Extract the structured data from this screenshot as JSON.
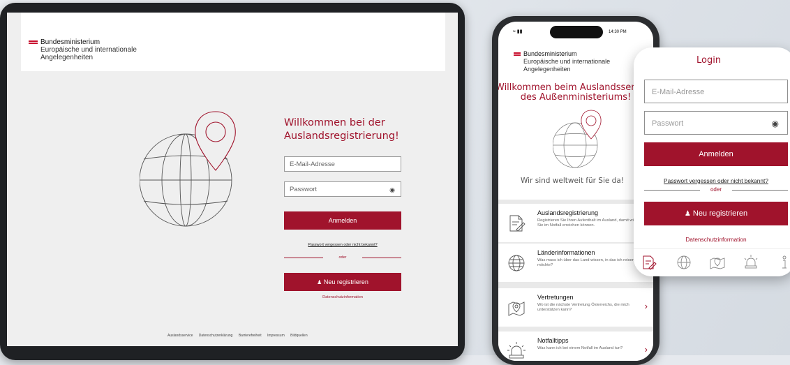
{
  "tablet": {
    "brand_line1": "Bundesministerium",
    "brand_line2": "Europäische und internationale",
    "brand_line3": "Angelegenheiten",
    "welcome_line1": "Willkommen bei der",
    "welcome_line2": "Auslandsregistrierung!",
    "email_placeholder": "E-Mail-Adresse",
    "password_placeholder": "Passwort",
    "login_label": "Anmelden",
    "forgot_label": "Passwort vergessen oder nicht bekannt?",
    "or_label": "oder",
    "register_label": "Neu registrieren",
    "privacy_label": "Datenschutzinformation",
    "footer": [
      "Auslandsservice",
      "Datenschutzerklärung",
      "Barrierefreiheit",
      "Impressum",
      "Bildquellen"
    ]
  },
  "phone": {
    "time": "14:30 PM",
    "brand_line1": "Bundesministerium",
    "brand_line2": "Europäische und internationale",
    "brand_line3": "Angelegenheiten",
    "welcome_line1": "Willkommen beim Auslandsservice",
    "welcome_line2": "des Außenministeriums!",
    "subtitle": "Wir sind weltweit für Sie da!",
    "items": [
      {
        "title": "Auslandsregistrierung",
        "desc": "Registrieren Sie Ihren Aufenthalt im Ausland, damit wir Sie im Notfall erreichen können.",
        "icon": "registration-icon"
      },
      {
        "title": "Länderinformationen",
        "desc": "Was muss ich über das Land wissen, in das ich reisen möchte?",
        "icon": "globe-icon"
      },
      {
        "title": "Vertretungen",
        "desc": "Wo ist die nächste Vertretung Österreichs, die mich unterstützen kann?",
        "icon": "map-pin-icon"
      },
      {
        "title": "Notfalltipps",
        "desc": "Was kann ich bei einem Notfall im Ausland tun?",
        "icon": "siren-icon"
      }
    ]
  },
  "card": {
    "title": "Login",
    "email_placeholder": "E-Mail-Adresse",
    "password_placeholder": "Passwort",
    "login_label": "Anmelden",
    "forgot_label": "Passwort vergessen oder nicht bekannt?",
    "or_label": "oder",
    "register_label": "Neu registrieren",
    "privacy_label": "Datenschutzinformation",
    "tabs": [
      "registration-icon",
      "globe-icon",
      "map-pin-icon",
      "siren-icon",
      "info-icon"
    ]
  },
  "colors": {
    "accent": "#a0132c",
    "flag_red": "#c8102e"
  }
}
